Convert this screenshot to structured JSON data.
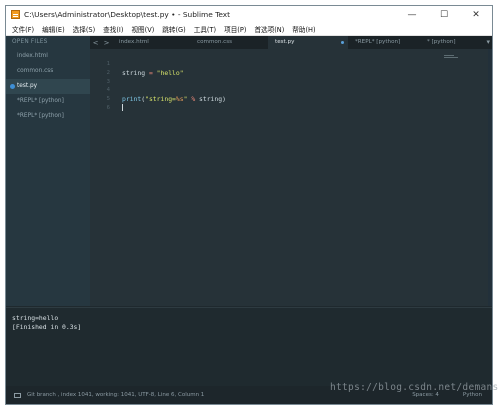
{
  "window": {
    "title": "C:\\Users\\Administrator\\Desktop\\test.py • - Sublime Text",
    "controls": {
      "minimize": "—",
      "maximize": "☐",
      "close": "✕"
    }
  },
  "menu": [
    "文件(F)",
    "编辑(E)",
    "选择(S)",
    "查找(I)",
    "视图(V)",
    "跳转(G)",
    "工具(T)",
    "项目(P)",
    "首选项(N)",
    "帮助(H)"
  ],
  "sidebar": {
    "header": "OPEN FILES",
    "files": [
      {
        "label": "index.html",
        "active": false
      },
      {
        "label": "common.css",
        "active": false
      },
      {
        "label": "test.py",
        "active": true
      },
      {
        "label": "*REPL* [python]",
        "active": false
      },
      {
        "label": "*REPL* [python]",
        "active": false
      }
    ]
  },
  "tabs": {
    "nav_left": "<",
    "nav_right": ">",
    "items": [
      {
        "label": "index.html"
      },
      {
        "label": "common.css"
      },
      {
        "label": "test.py",
        "active": true
      },
      {
        "label": "*REPL* [python]"
      },
      {
        "label": "* [python]"
      }
    ]
  },
  "editor": {
    "line_numbers": [
      "1",
      "2",
      "3",
      "4",
      "5",
      "6"
    ],
    "lines": [
      "",
      "string = \"hello\"",
      "",
      "",
      "print(\"string=%s\" % string)",
      ""
    ]
  },
  "output": {
    "lines": [
      "string=hello",
      "[Finished in 0.3s]"
    ]
  },
  "status": {
    "left": "Git branch , index 1041, working: 1041, UTF-8, Line 6, Column 1",
    "right1": "Spaces: 4",
    "right2": "Python"
  },
  "watermark": "https://blog.csdn.net/demans"
}
